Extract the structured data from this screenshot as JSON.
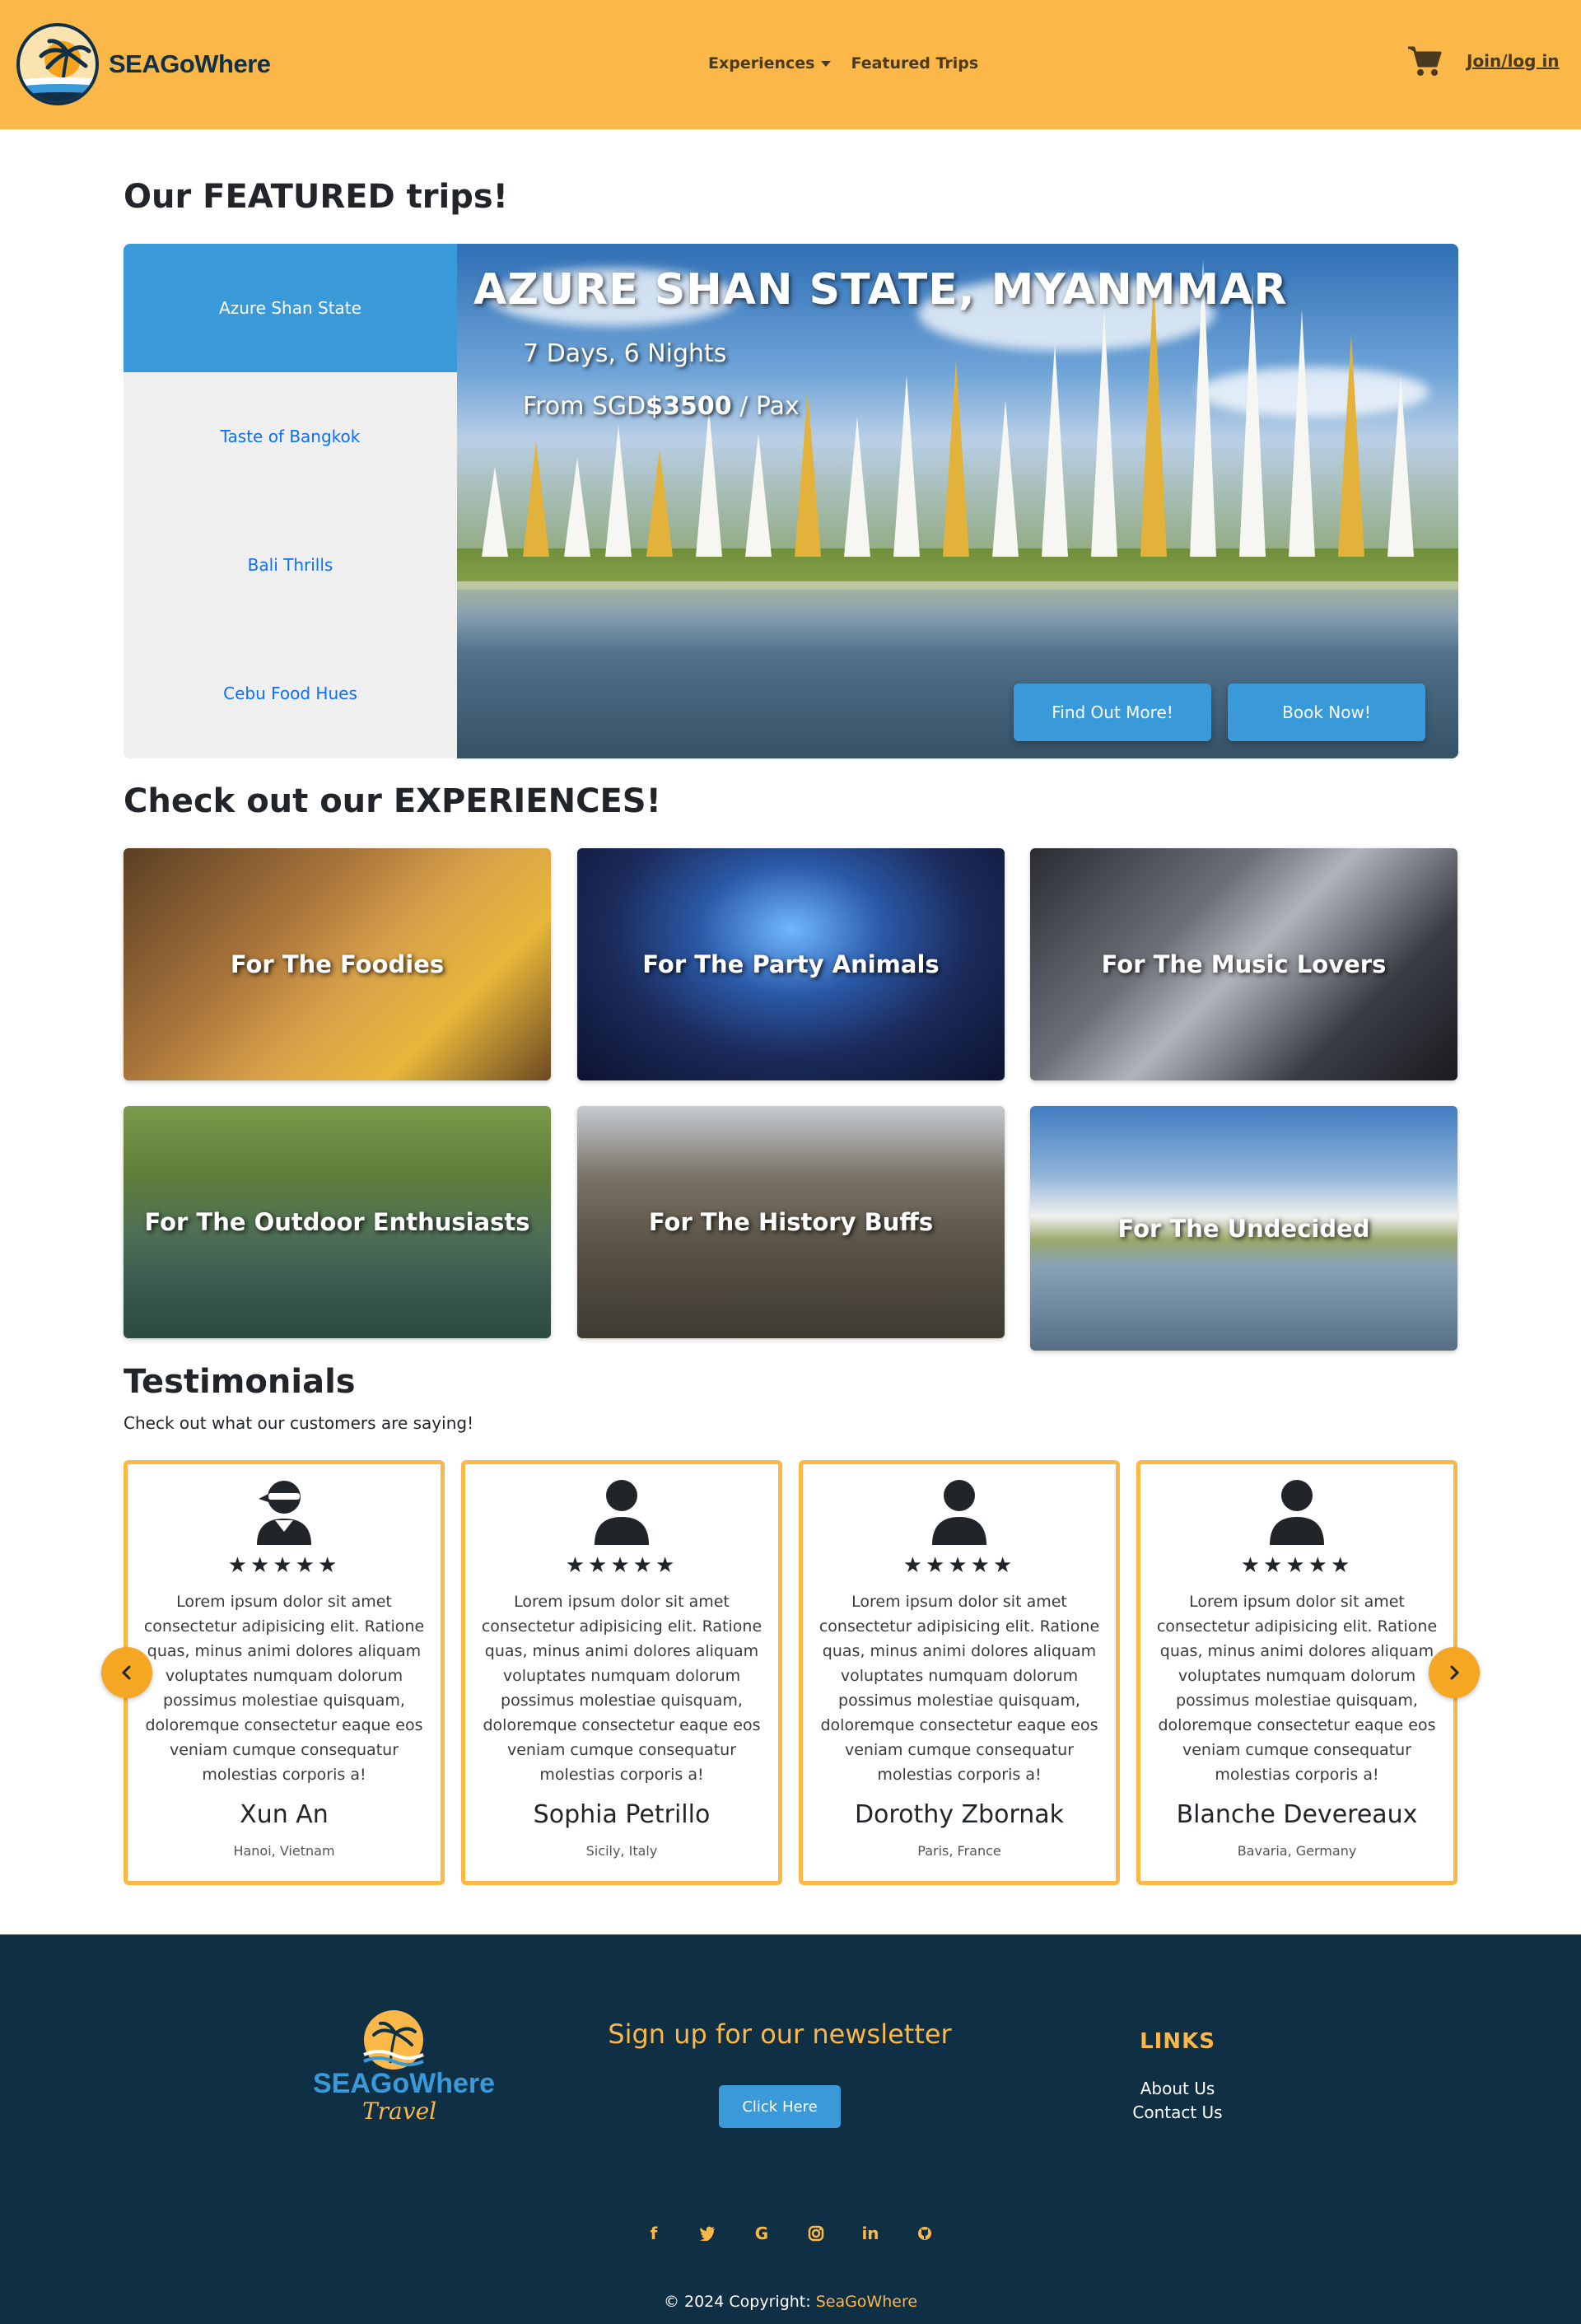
{
  "navbar": {
    "brand": "SEAGoWhere",
    "experiences_label": "Experiences",
    "featured_label": "Featured Trips",
    "login_label": "Join/log in"
  },
  "featured": {
    "heading": "Our FEATURED trips!",
    "tabs": [
      "Azure Shan State",
      "Taste of Bangkok",
      "Bali Thrills",
      "Cebu Food Hues"
    ],
    "active_tab": 0,
    "title": "AZURE SHAN STATE, MYANMMAR",
    "duration": "7 Days, 6 Nights",
    "price_prefix": "From SGD",
    "price": "$3500",
    "price_suffix": " / Pax",
    "find_out_label": "Find Out More!",
    "book_label": "Book Now!"
  },
  "experiences": {
    "heading": "Check out our EXPERIENCES!",
    "cards": [
      {
        "label": "For The Foodies"
      },
      {
        "label": "For The Party Animals"
      },
      {
        "label": "For The Music Lovers"
      },
      {
        "label": "For The Outdoor Enthusiasts"
      },
      {
        "label": "For The History Buffs"
      },
      {
        "label": "For The Undecided"
      }
    ]
  },
  "testimonials": {
    "heading": "Testimonials",
    "subheading": "Check out what our customers are saying!",
    "stars": "★★★★★",
    "items": [
      {
        "text": "Lorem ipsum dolor sit amet consectetur adipisicing elit. Ratione quas, minus animi dolores aliquam voluptates numquam dolorum possimus molestiae quisquam, doloremque consectetur eaque eos veniam cumque consequatur molestias corporis a!",
        "name": "Xun An",
        "location": "Hanoi, Vietnam",
        "avatar": "ninja-avatar-icon"
      },
      {
        "text": "Lorem ipsum dolor sit amet consectetur adipisicing elit. Ratione quas, minus animi dolores aliquam voluptates numquam dolorum possimus molestiae quisquam, doloremque consectetur eaque eos veniam cumque consequatur molestias corporis a!",
        "name": "Sophia Petrillo",
        "location": "Sicily, Italy",
        "avatar": "user-avatar-icon"
      },
      {
        "text": "Lorem ipsum dolor sit amet consectetur adipisicing elit. Ratione quas, minus animi dolores aliquam voluptates numquam dolorum possimus molestiae quisquam, doloremque consectetur eaque eos veniam cumque consequatur molestias corporis a!",
        "name": "Dorothy Zbornak",
        "location": "Paris, France",
        "avatar": "user-avatar-icon"
      },
      {
        "text": "Lorem ipsum dolor sit amet consectetur adipisicing elit. Ratione quas, minus animi dolores aliquam voluptates numquam dolorum possimus molestiae quisquam, doloremque consectetur eaque eos veniam cumque consequatur molestias corporis a!",
        "name": "Blanche Devereaux",
        "location": "Bavaria, Germany",
        "avatar": "user-avatar-icon"
      }
    ]
  },
  "footer": {
    "logo_text": "SEAGoWhere",
    "logo_script": "Travel",
    "newsletter_heading": "Sign up for our newsletter",
    "newsletter_button": "Click Here",
    "links_heading": "LINKS",
    "links": [
      "About Us",
      "Contact Us"
    ],
    "social_icons": [
      "facebook-icon",
      "twitter-icon",
      "google-icon",
      "instagram-icon",
      "linkedin-icon",
      "github-icon"
    ],
    "copyright_prefix": "© 2024 Copyright: ",
    "copyright_brand": "SeaGoWhere"
  },
  "colors": {
    "navbar": "#fbb747",
    "accent_blue": "#3a9ad9",
    "footer": "#0f2f45",
    "card_border": "#fbb747"
  }
}
